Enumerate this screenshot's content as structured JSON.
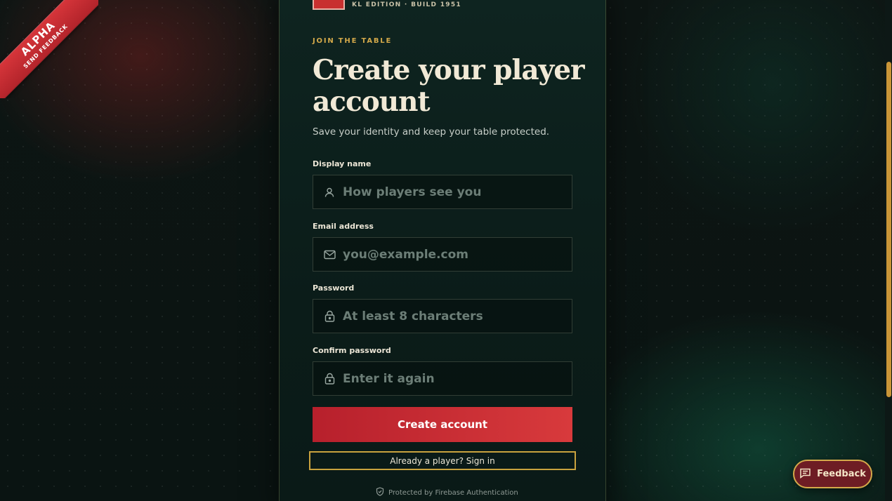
{
  "ribbon": {
    "title": "ALPHA",
    "subtitle": "SEND FEEDBACK"
  },
  "brand": {
    "edition": "KL EDITION · BUILD 1951"
  },
  "header": {
    "eyebrow": "JOIN THE TABLE",
    "title": "Create your player account",
    "subtitle": "Save your identity and keep your table protected."
  },
  "form": {
    "display_name": {
      "label": "Display name",
      "placeholder": "How players see you",
      "icon": "user-icon"
    },
    "email": {
      "label": "Email address",
      "placeholder": "you@example.com",
      "icon": "mail-icon"
    },
    "password": {
      "label": "Password",
      "placeholder": "At least 8 characters",
      "icon": "lock-icon"
    },
    "confirm_password": {
      "label": "Confirm password",
      "placeholder": "Enter it again",
      "icon": "lock-icon"
    },
    "submit_label": "Create account",
    "signin_label": "Already a player? Sign in"
  },
  "footer": {
    "protected_text": "Protected by Firebase Authentication",
    "icon": "shield-icon"
  },
  "feedback": {
    "label": "Feedback",
    "icon": "chat-icon"
  },
  "colors": {
    "accent_red": "#c8302f",
    "accent_gold": "#d4a94a",
    "card_bg": "#0e2420"
  }
}
